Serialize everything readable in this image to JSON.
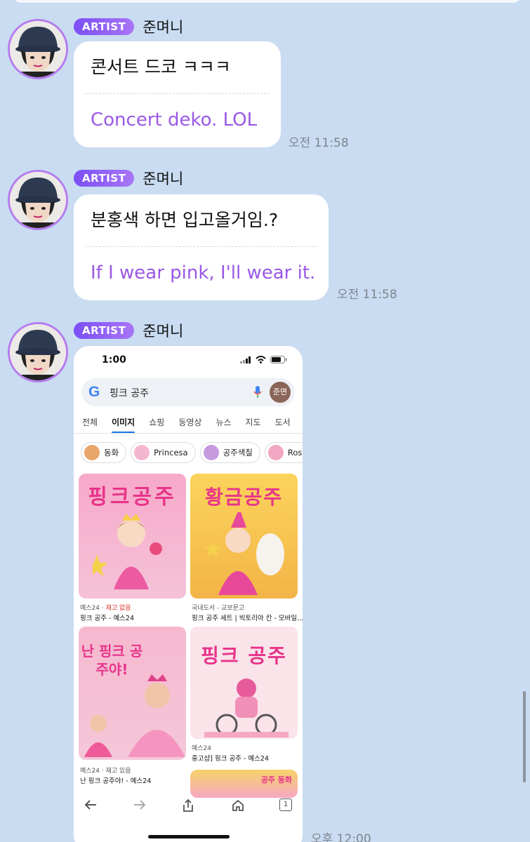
{
  "messages": [
    {
      "badge": "ARTIST",
      "nickname": "준며니",
      "original": "콘서트 드코 ㅋㅋㅋ",
      "translation": "Concert deko. LOL",
      "time": "오전 11:58"
    },
    {
      "badge": "ARTIST",
      "nickname": "준며니",
      "original": "분홍색 하면 입고올거임.?",
      "translation": "If I wear pink, I'll wear it.",
      "time": "오전 11:58"
    },
    {
      "badge": "ARTIST",
      "nickname": "준며니",
      "time": "오후 12:00"
    }
  ],
  "screenshot": {
    "status_time": "1:00",
    "search_query": "핑크 공주",
    "profile_initials": "준면",
    "tabs": [
      "전체",
      "이미지",
      "쇼핑",
      "동영상",
      "뉴스",
      "지도",
      "도서"
    ],
    "active_tab": "이미지",
    "chips": [
      "동화",
      "Princesa",
      "공주색칠",
      "Rosa"
    ],
    "results": [
      {
        "cover_title": "핑크공주",
        "source": "예스24",
        "stock": "재고 없음",
        "title": "핑크 공주 - 예스24"
      },
      {
        "cover_title": "황금공주",
        "source": "국내도서 - 교보문고",
        "stock": "",
        "title": "핑크 공주 세트 | 빅토리아 칸 - 모바일..."
      },
      {
        "cover_title": "난 핑크 공주야!",
        "source": "예스24",
        "stock": "재고 있음",
        "title": "난 핑크 공주야! - 예스24"
      },
      {
        "cover_title": "핑크 공주",
        "source": "예스24",
        "stock": "",
        "title": "중고샵] 핑크 공주 - 예스24"
      },
      {
        "cover_title": "공주 동화",
        "source": "",
        "stock": "",
        "title": ""
      }
    ],
    "nav_icons": [
      "back-arrow-icon",
      "forward-arrow-icon",
      "share-icon",
      "home-icon",
      "tabs-icon"
    ],
    "tab_count": "1"
  },
  "colors": {
    "background": "#c9dcf1",
    "badge": "#8a5cf6",
    "translation_text": "#9a58e6",
    "avatar_ring": "#b57cf0"
  }
}
